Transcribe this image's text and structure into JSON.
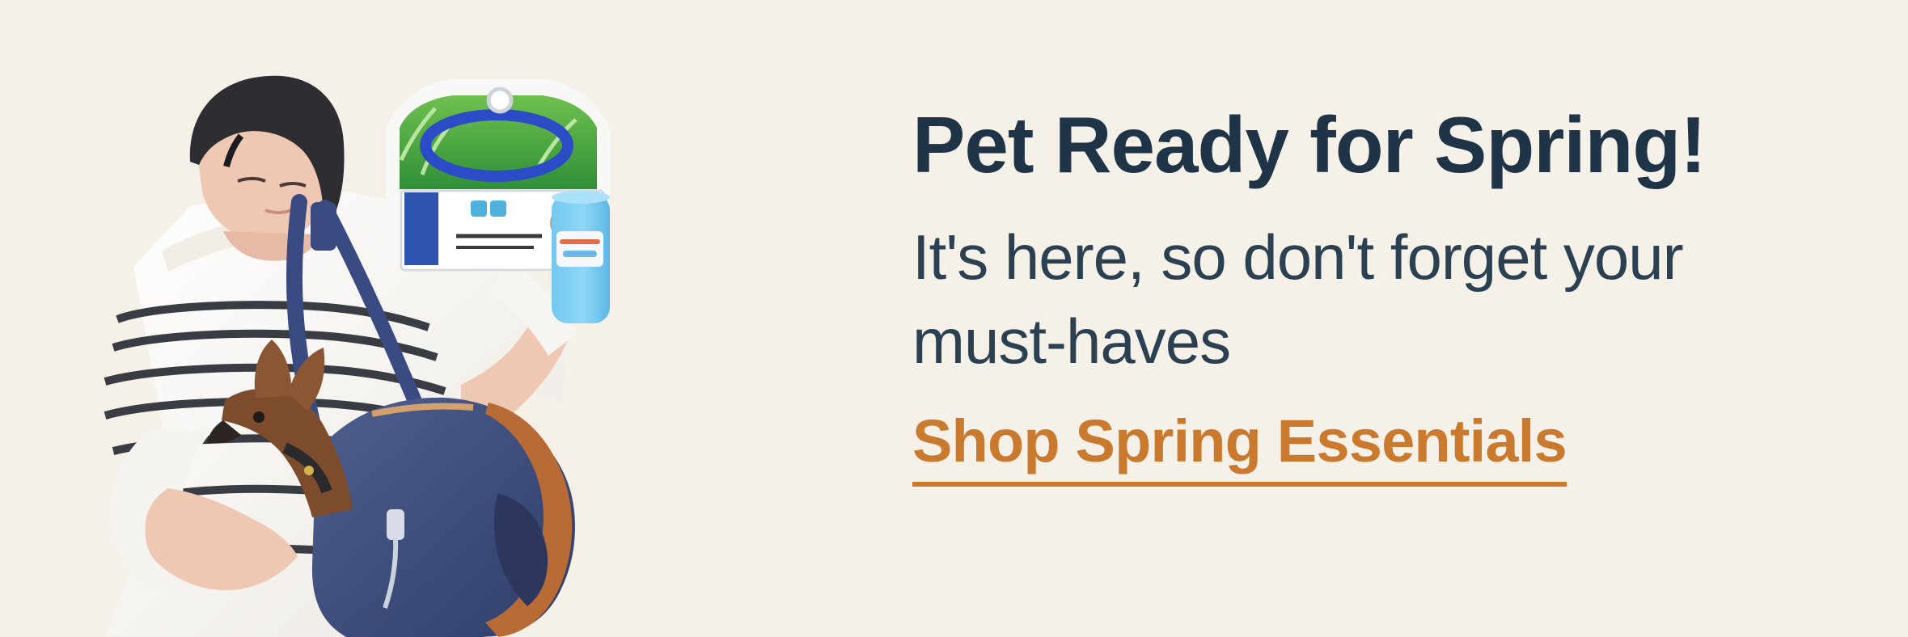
{
  "banner": {
    "headline": "Pet Ready for Spring!",
    "subheadline": "It's here, so don't forget your must-haves",
    "cta_label": "Shop Spring Essentials",
    "colors": {
      "background": "#f5f1e8",
      "headline": "#1f3446",
      "body": "#2b4152",
      "accent": "#c97a2f"
    }
  }
}
